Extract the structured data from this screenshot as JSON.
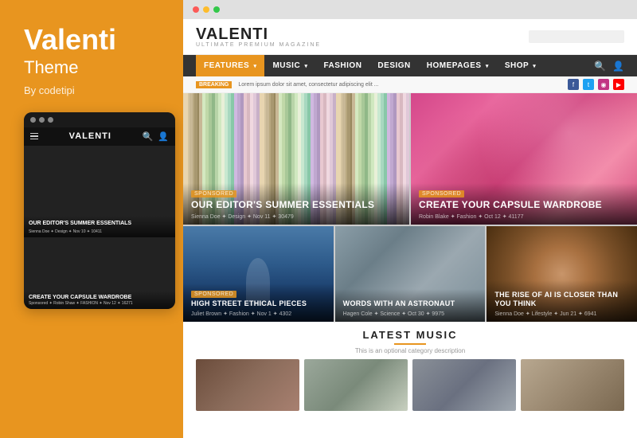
{
  "left": {
    "brand_name": "Valenti",
    "theme_label": "Theme",
    "author": "By codetipi",
    "mobile": {
      "dots": [
        "dot1",
        "dot2",
        "dot3"
      ],
      "nav_logo": "VALENTI",
      "hero_title": "OUR EDITOR'S SUMMER ESSENTIALS",
      "hero_meta": "Sienna Doe  ✦ Design  ✦ Nov 10  ✦ 10411",
      "card2_title": "CREATE YOUR CAPSULE WARDROBE",
      "card2_meta": "Sponsored  ✦ Robin Shaw  ✦ FASHION  ✦ Nov 12  ✦ 16271"
    }
  },
  "right": {
    "browser_dots": [
      "red",
      "yellow",
      "green"
    ],
    "site": {
      "logo": "VALENTI",
      "logo_tagline": "ULTIMATE PREMIUM MAGAZINE",
      "nav_items": [
        {
          "label": "FEATURES",
          "has_arrow": true,
          "active": true
        },
        {
          "label": "MUSIC",
          "has_arrow": true,
          "active": false
        },
        {
          "label": "FASHION",
          "has_arrow": false,
          "active": false
        },
        {
          "label": "DESIGN",
          "has_arrow": false,
          "active": false
        },
        {
          "label": "HOMEPAGES",
          "has_arrow": true,
          "active": false
        },
        {
          "label": "SHOP",
          "has_arrow": true,
          "active": false
        }
      ],
      "breaking_label": "BREAKING",
      "breaking_text": "Lorem ipsum dolor sit amet, consectetur adipiscing elit ...",
      "social": [
        "f",
        "t",
        "◉",
        "▶"
      ],
      "cards": [
        {
          "tag": "Sponsored",
          "title": "OUR EDITOR'S SUMMER ESSENTIALS",
          "meta": "Sienna Doe  ✦ Design  ✦ Nov 11  ✦ 30479"
        },
        {
          "tag": "Sponsored",
          "title": "CREATE YOUR CAPSULE WARDROBE",
          "meta": "Robin Blake  ✦ Fashion  ✦ Oct 12  ✦ 41177"
        },
        {
          "tag": "Sponsored",
          "title": "HIGH STREET ETHICAL PIECES",
          "meta": "Juliet Brown  ✦ Fashion  ✦ Nov 1  ✦ 4302"
        },
        {
          "tag": "",
          "title": "WORDS WITH AN ASTRONAUT",
          "meta": "Hagen Cole  ✦ Science  ✦ Oct 30  ✦ 9975"
        },
        {
          "tag": "",
          "title": "THE RISE OF AI IS CLOSER THAN YOU THINK",
          "meta": "Sienna Doe  ✦ Lifestyle  ✦ Jun 21  ✦ 6941"
        }
      ],
      "latest_title": "LATEST MUSIC",
      "latest_desc": "This is an optional category description"
    }
  }
}
